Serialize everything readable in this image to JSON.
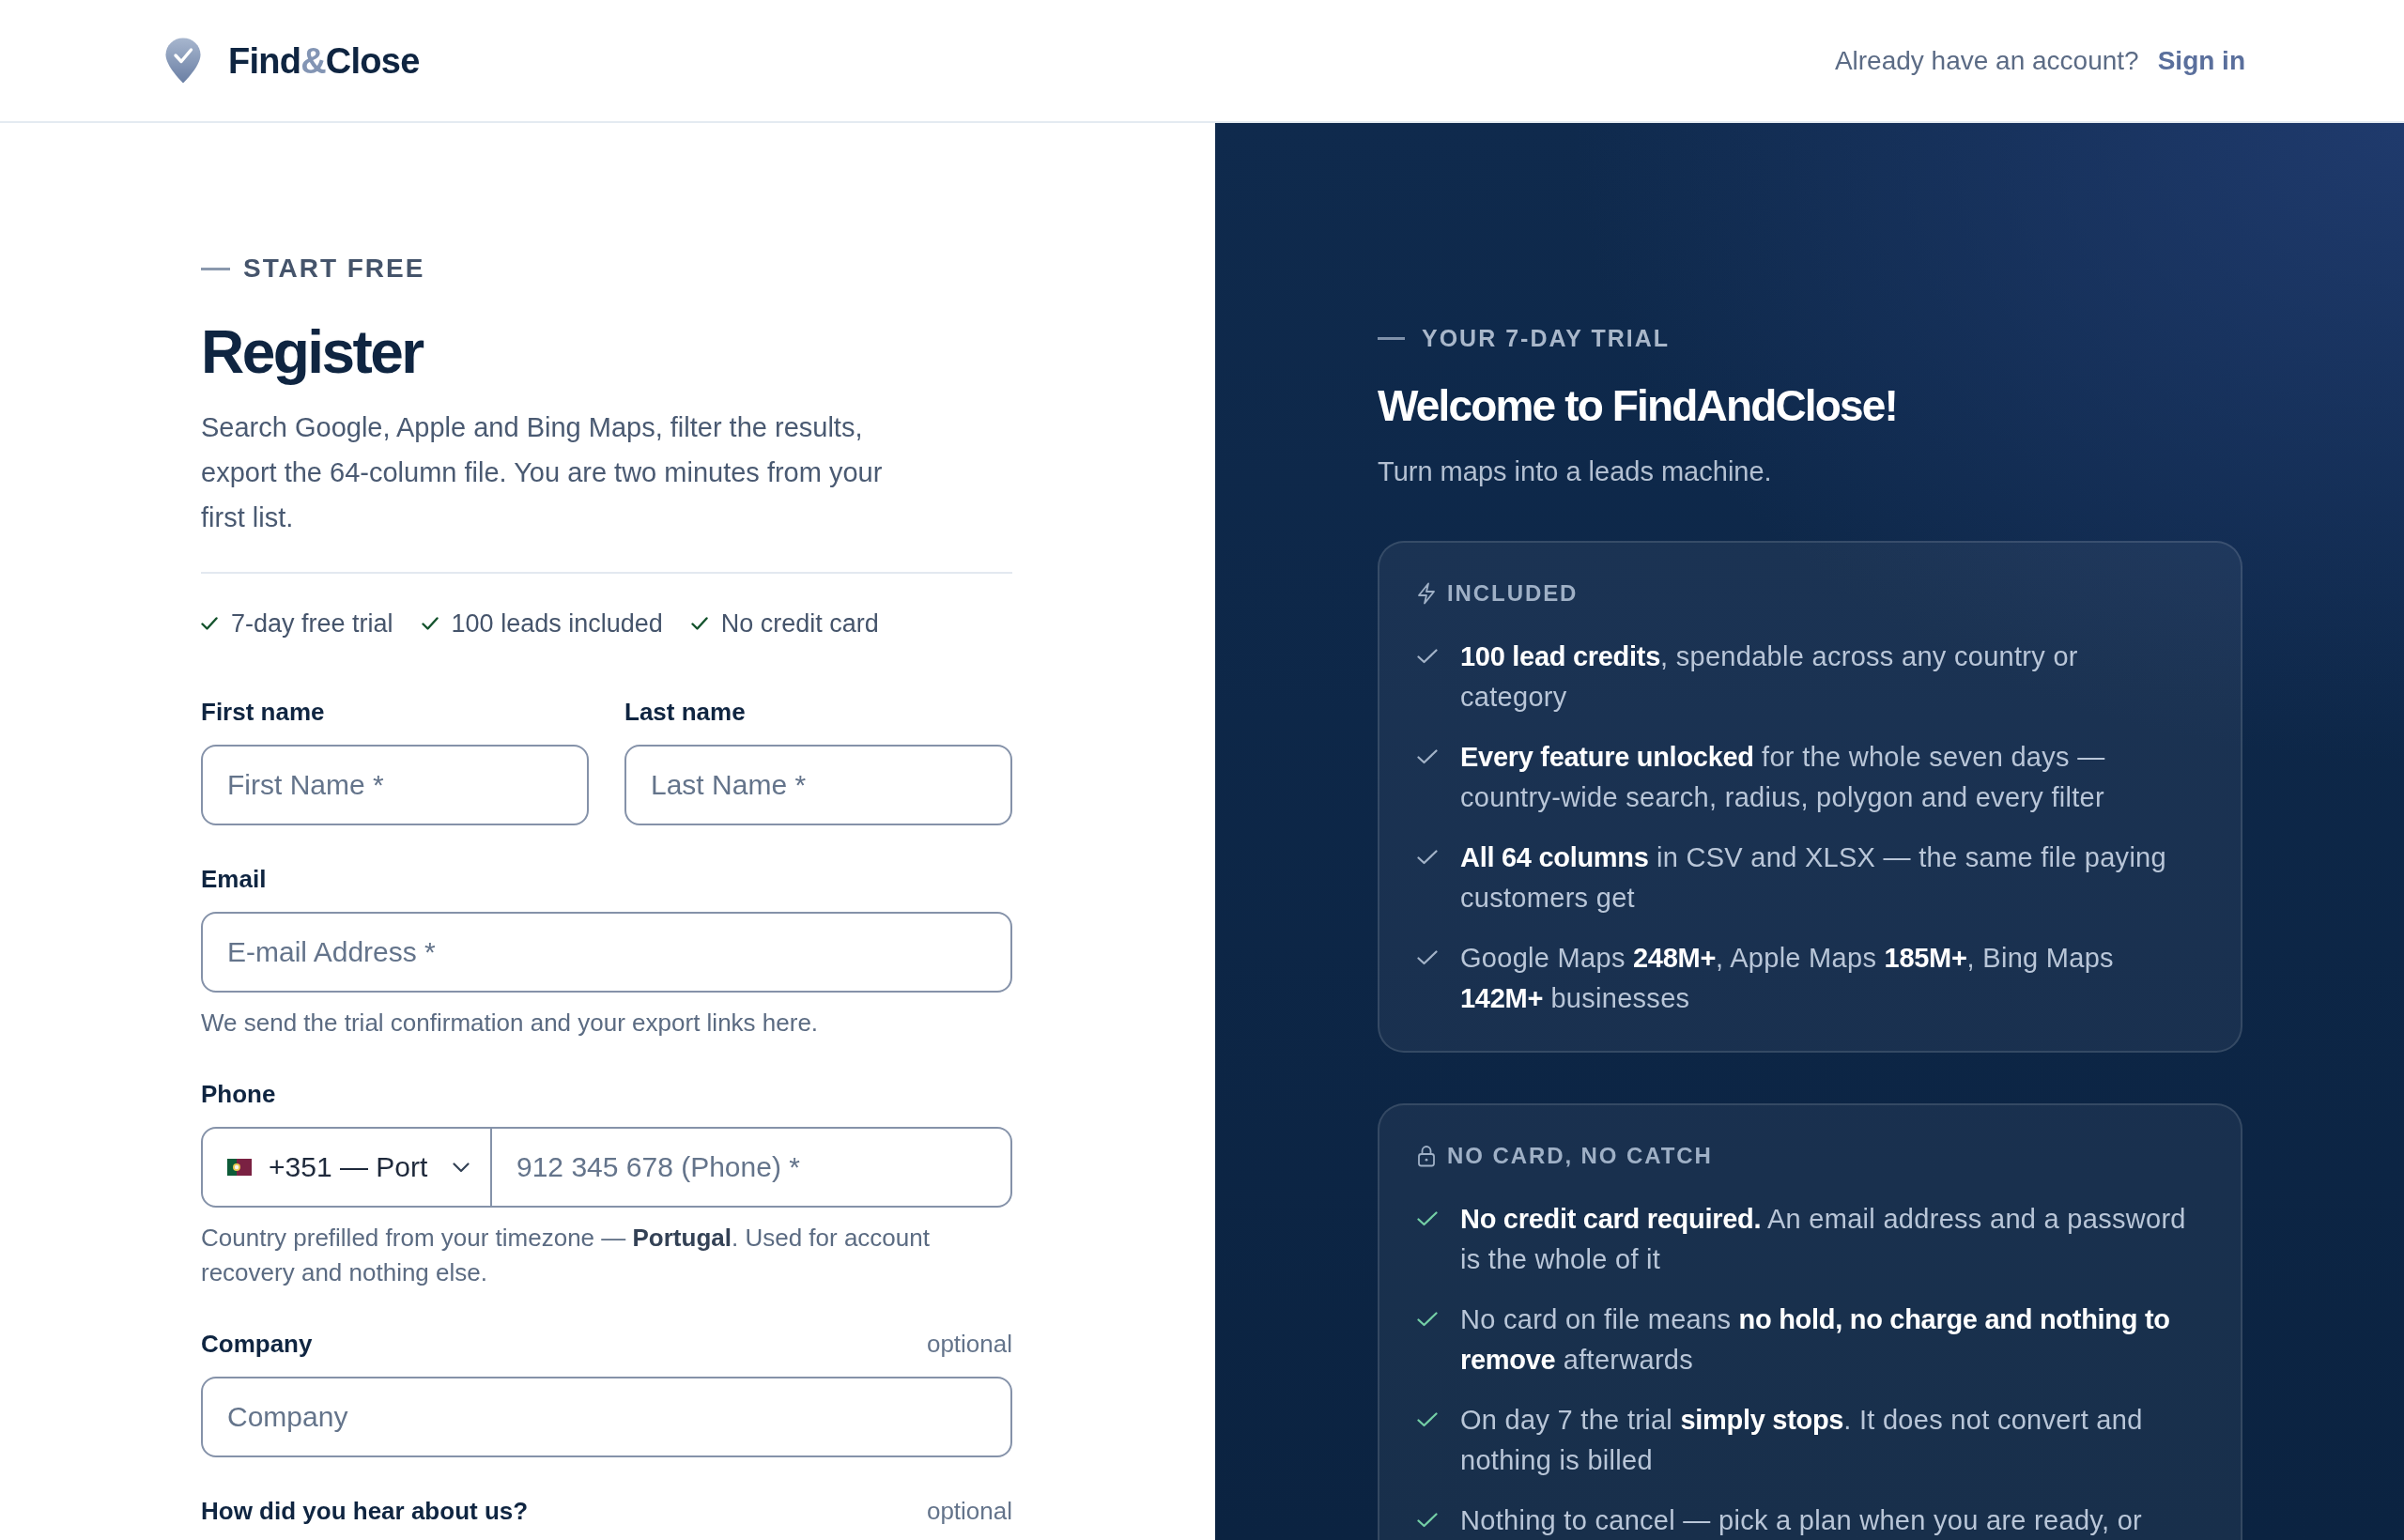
{
  "header": {
    "logo": [
      {
        "text": "Find",
        "accent": false
      },
      {
        "text": "&",
        "accent": true
      },
      {
        "text": "Close",
        "accent": false
      }
    ],
    "prompt": "Already have an account?",
    "sign_in_link": "Sign in"
  },
  "form_panel": {
    "eyebrow": "START FREE",
    "title": "Register",
    "intro": "Search Google, Apple and Bing Maps, filter the results, export the 64-column file. You are two minutes from your first list.",
    "perks": [
      "7-day free trial",
      "100 leads included",
      "No credit card"
    ],
    "name_fields": [
      {
        "label": "First name",
        "placeholder": "First Name *"
      },
      {
        "label": "Last name",
        "placeholder": "Last Name *"
      }
    ],
    "email_field": {
      "label": "Email",
      "placeholder": "E-mail Address *",
      "hint": "We send the trial confirmation and your export links here."
    },
    "phone_field": {
      "label": "Phone",
      "country_code": "+351 — Port",
      "placeholder": "912 345 678 (Phone) *",
      "hint": "Country prefilled from your timezone — **Portugal**. Used for account recovery and nothing else."
    },
    "company_field": {
      "label": "Company",
      "note": "optional",
      "placeholder": "Company"
    },
    "referral_field": {
      "label": "How did you hear about us?",
      "note": "optional"
    }
  },
  "trial_panel": {
    "eyebrow": "YOUR 7-DAY TRIAL",
    "title": "Welcome to FindAndClose!",
    "subtitle": "Turn maps into a leads machine.",
    "cards": [
      {
        "kind": "included",
        "heading": "INCLUDED",
        "items": [
          "**100 lead credits**, spendable across any country or category",
          "**Every feature unlocked** for the whole seven days — country-wide search, radius, polygon and every filter",
          "**All 64 columns** in CSV and XLSX — the same file paying customers get",
          "Google Maps **248M+**, Apple Maps **185M+**, Bing Maps **142M+** businesses"
        ]
      },
      {
        "kind": "guarantee",
        "heading": "NO CARD, NO CATCH",
        "items": [
          "**No credit card required.** An email address and a password is the whole of it",
          "No card on file means **no hold, no charge and nothing to remove** afterwards",
          "On day 7 the trial **simply stops**. It does not convert and nothing is billed",
          "Nothing to cancel — pick a plan when you are ready, or"
        ]
      }
    ]
  }
}
